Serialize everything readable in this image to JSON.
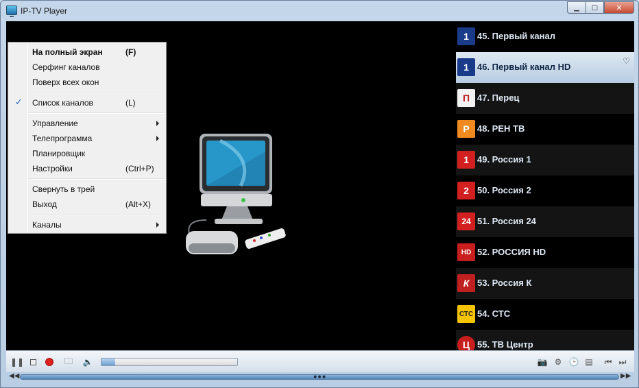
{
  "window": {
    "title": "IP-TV Player"
  },
  "menu": {
    "items": [
      {
        "label": "На полный экран",
        "shortcut": "(F)",
        "bold": true
      },
      {
        "label": "Серфинг каналов",
        "shortcut": ""
      },
      {
        "label": "Поверх всех окон",
        "shortcut": ""
      },
      {
        "label": "Список каналов",
        "shortcut": "(L)",
        "checked": true
      },
      {
        "label": "Управление",
        "shortcut": "",
        "submenu": true
      },
      {
        "label": "Телепрограмма",
        "shortcut": "",
        "submenu": true
      },
      {
        "label": "Планировщик",
        "shortcut": ""
      },
      {
        "label": "Настройки",
        "shortcut": "(Ctrl+P)"
      },
      {
        "label": "Свернуть в трей",
        "shortcut": ""
      },
      {
        "label": "Выход",
        "shortcut": "(Alt+X)"
      },
      {
        "label": "Каналы",
        "shortcut": "",
        "submenu": true
      }
    ]
  },
  "channels": [
    {
      "name": "45. Первый канал",
      "logo_text": "1",
      "logo_color": "#1a3a8a"
    },
    {
      "name": "46. Первый канал HD",
      "logo_text": "1",
      "logo_color": "#1a3a8a",
      "selected": true
    },
    {
      "name": "47. Перец",
      "logo_text": "П",
      "logo_color": "#f2f2f2"
    },
    {
      "name": "48. РЕН ТВ",
      "logo_text": "Р",
      "logo_color": "#f08a20"
    },
    {
      "name": "49. Россия 1",
      "logo_text": "1",
      "logo_color": "#d22020"
    },
    {
      "name": "50. Россия 2",
      "logo_text": "2",
      "logo_color": "#d22020"
    },
    {
      "name": "51. Россия 24",
      "logo_text": "24",
      "logo_color": "#d22020"
    },
    {
      "name": "52. РОССИЯ HD",
      "logo_text": "HD",
      "logo_color": "#c81e1e"
    },
    {
      "name": "53. Россия К",
      "logo_text": "К",
      "logo_color": "#c02020"
    },
    {
      "name": "54. СТС",
      "logo_text": "СТС",
      "logo_color": "#f6c400"
    },
    {
      "name": "55. ТВ Центр",
      "logo_text": "Ц",
      "logo_color": "#c81e1e"
    }
  ],
  "controls": {
    "volume": 0.1,
    "icons": [
      "pause-icon",
      "stop-icon",
      "record-icon",
      "open-folder-icon",
      "volume-icon",
      "camera-icon",
      "gear-icon",
      "clock-icon",
      "notes-icon",
      "prev-icon",
      "next-icon"
    ]
  },
  "colors": {
    "accent": "#6d9fd1",
    "record": "#e02020"
  }
}
